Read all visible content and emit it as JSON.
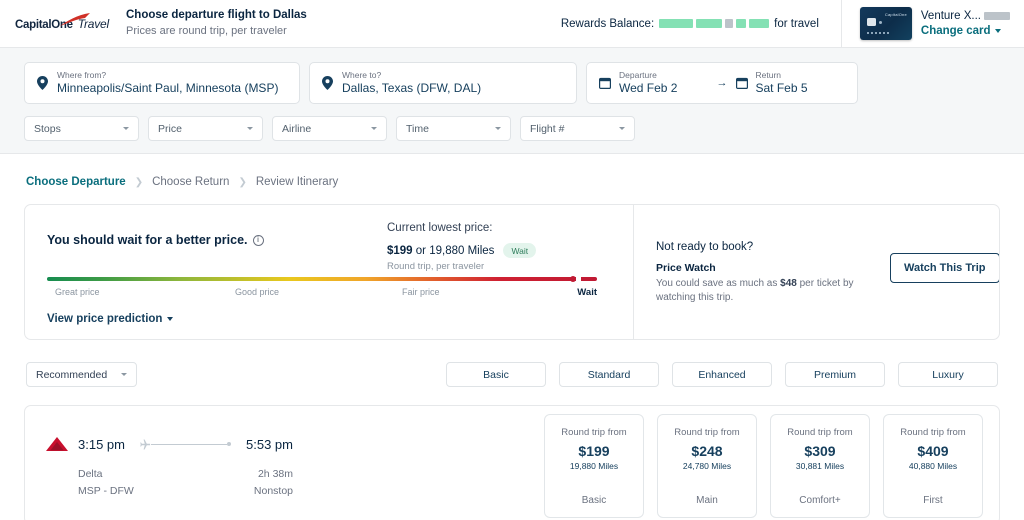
{
  "header": {
    "logo_capital": "Capital",
    "logo_one": "One",
    "logo_travel": "Travel",
    "title": "Choose departure flight to Dallas",
    "subtitle": "Prices are round trip, per traveler",
    "rewards_label": "Rewards Balance:",
    "rewards_value_redacted": true,
    "rewards_suffix": "for travel",
    "card_name": "Venture X...",
    "card_brand": "CapitalOne",
    "change_card_label": "Change card"
  },
  "search": {
    "from": {
      "label": "Where from?",
      "value": "Minneapolis/Saint Paul, Minnesota (MSP)",
      "icon": "location-pin-icon"
    },
    "to": {
      "label": "Where to?",
      "value": "Dallas, Texas (DFW, DAL)",
      "icon": "location-pin-icon"
    },
    "departure": {
      "label": "Departure",
      "value": "Wed Feb 2",
      "icon": "calendar-icon"
    },
    "return": {
      "label": "Return",
      "value": "Sat Feb 5",
      "icon": "calendar-icon"
    },
    "arrow": "→",
    "filters": [
      {
        "label": "Stops"
      },
      {
        "label": "Price"
      },
      {
        "label": "Airline"
      },
      {
        "label": "Time"
      },
      {
        "label": "Flight #"
      }
    ]
  },
  "breadcrumb": {
    "items": [
      {
        "label": "Choose Departure",
        "active": true
      },
      {
        "label": "Choose Return",
        "active": false
      },
      {
        "label": "Review Itinerary",
        "active": false
      }
    ],
    "separator": "❯"
  },
  "price_prediction": {
    "headline": "You should wait for a better price.",
    "info_icon": "info-icon",
    "current_lowest_label": "Current lowest price:",
    "price": "$199",
    "price_connector": " or ",
    "miles": "19,880 Miles",
    "badge": "Wait",
    "price_note": "Round trip, per traveler",
    "gauge_labels": [
      "Great price",
      "Good price",
      "Fair price",
      "Wait"
    ],
    "gauge_marker_position_pct": 96,
    "view_prediction_label": "View price prediction",
    "colors": {
      "great": "#168c50",
      "good": "#e9c81e",
      "fair": "#f0a52a",
      "wait": "#c01933",
      "badge_bg": "#e3f4ec",
      "badge_text": "#2e7d5b",
      "accent_teal": "#0a6e7d",
      "navy": "#17405e"
    }
  },
  "price_watch": {
    "heading": "Not ready to book?",
    "subheading": "Price Watch",
    "body_prefix": "You could save as much as ",
    "body_amount": "$48",
    "body_suffix": " per ticket by watching this trip.",
    "button_label": "Watch This Trip"
  },
  "fare_tabs": {
    "sort_label": "Recommended",
    "tabs": [
      {
        "label": "Basic"
      },
      {
        "label": "Standard"
      },
      {
        "label": "Enhanced"
      },
      {
        "label": "Premium"
      },
      {
        "label": "Luxury"
      }
    ]
  },
  "flight": {
    "airline_logo": "delta-logo-icon",
    "depart_time": "3:15 pm",
    "arrive_time": "5:53 pm",
    "airline": "Delta",
    "route": "MSP - DFW",
    "duration": "2h 38m",
    "stops": "Nonstop",
    "fares": [
      {
        "top": "Round trip from",
        "price": "$199",
        "miles": "19,880 Miles",
        "name": "Basic"
      },
      {
        "top": "Round trip from",
        "price": "$248",
        "miles": "24,780 Miles",
        "name": "Main"
      },
      {
        "top": "Round trip from",
        "price": "$309",
        "miles": "30,881 Miles",
        "name": "Comfort+"
      },
      {
        "top": "Round trip from",
        "price": "$409",
        "miles": "40,880 Miles",
        "name": "First"
      }
    ]
  }
}
